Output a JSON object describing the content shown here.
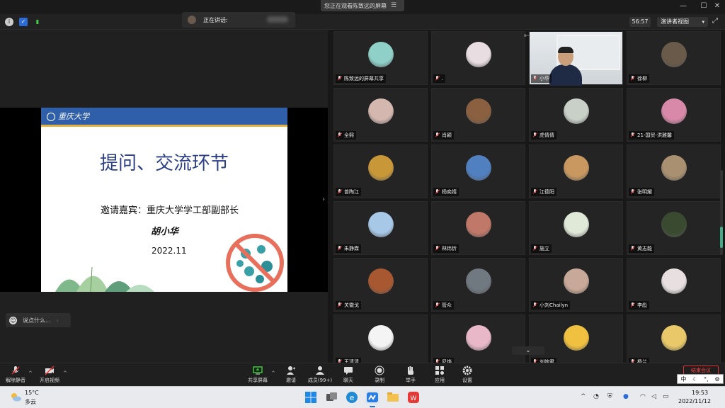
{
  "window": {
    "share_banner": "您正在观看陈致远的屏幕",
    "menu_icon": "menu-icon"
  },
  "toolbar": {
    "speaking_label": "正在讲话:",
    "timer": "56:57",
    "view_mode": "演讲者视图"
  },
  "slide": {
    "logo_text": "重庆大学",
    "title": "提问、交流环节",
    "guest": "邀请嘉宾：重庆大学学工部副部长",
    "name": "胡小华",
    "date": "2022.11"
  },
  "chat": {
    "placeholder": "说点什么..."
  },
  "participants": [
    {
      "name": "陈致远的屏幕共享",
      "color": "#8fd0c8",
      "icon": "screen-share-icon"
    },
    {
      "name": ".",
      "color": "#e8dde0"
    },
    {
      "name": "小华",
      "video": true
    },
    {
      "name": "徐柳",
      "color": "#6a5a4a",
      "icon": "person-icon"
    },
    {
      "name": "全熙",
      "color": "#d4b8b0"
    },
    {
      "name": "肖颖",
      "color": "#8a6040"
    },
    {
      "name": "虎倩倩",
      "color": "#c8d0c8"
    },
    {
      "name": "21-国贸-洪雅馨",
      "color": "#d888a8"
    },
    {
      "name": "曾陶江",
      "color": "#c89838"
    },
    {
      "name": "杨奕婧",
      "color": "#5080c0"
    },
    {
      "name": "江德阳",
      "color": "#c89860"
    },
    {
      "name": "张明耀",
      "color": "#a89070"
    },
    {
      "name": "朱静霖",
      "color": "#a8c8e8"
    },
    {
      "name": "林炜忻",
      "color": "#c07868"
    },
    {
      "name": "施立",
      "color": "#e0e8d8"
    },
    {
      "name": "黄志能",
      "color": "#3a4a30"
    },
    {
      "name": "关徽戈",
      "color": "#a85830"
    },
    {
      "name": "管众",
      "color": "#707880"
    },
    {
      "name": "小刘Chailyn",
      "color": "#c8a898"
    },
    {
      "name": "李彪",
      "color": "#e8e0e0"
    },
    {
      "name": "王清清",
      "color": "#f4f4f4"
    },
    {
      "name": "尼烨",
      "color": "#e8b8c8"
    },
    {
      "name": "刘婉君",
      "color": "#f0c040"
    },
    {
      "name": "杨兰",
      "color": "#e8c868"
    }
  ],
  "controls": {
    "unmute": "解除静音",
    "start_video": "开启视频",
    "share_screen": "共享屏幕",
    "invite": "邀请",
    "members": "成员(99+)",
    "chat": "聊天",
    "record": "录制",
    "raise_hand": "举手",
    "apps": "应用",
    "settings": "设置",
    "end": "结束会议"
  },
  "ime": {
    "mode": "中"
  },
  "taskbar": {
    "temperature": "15°C",
    "weather": "多云",
    "time": "19:53",
    "date": "2022/11/12"
  },
  "colors": {
    "slide_header": "#2f5fa8",
    "slide_title": "#2c3f86",
    "accent_green": "#4a8",
    "end_red": "#e44"
  }
}
